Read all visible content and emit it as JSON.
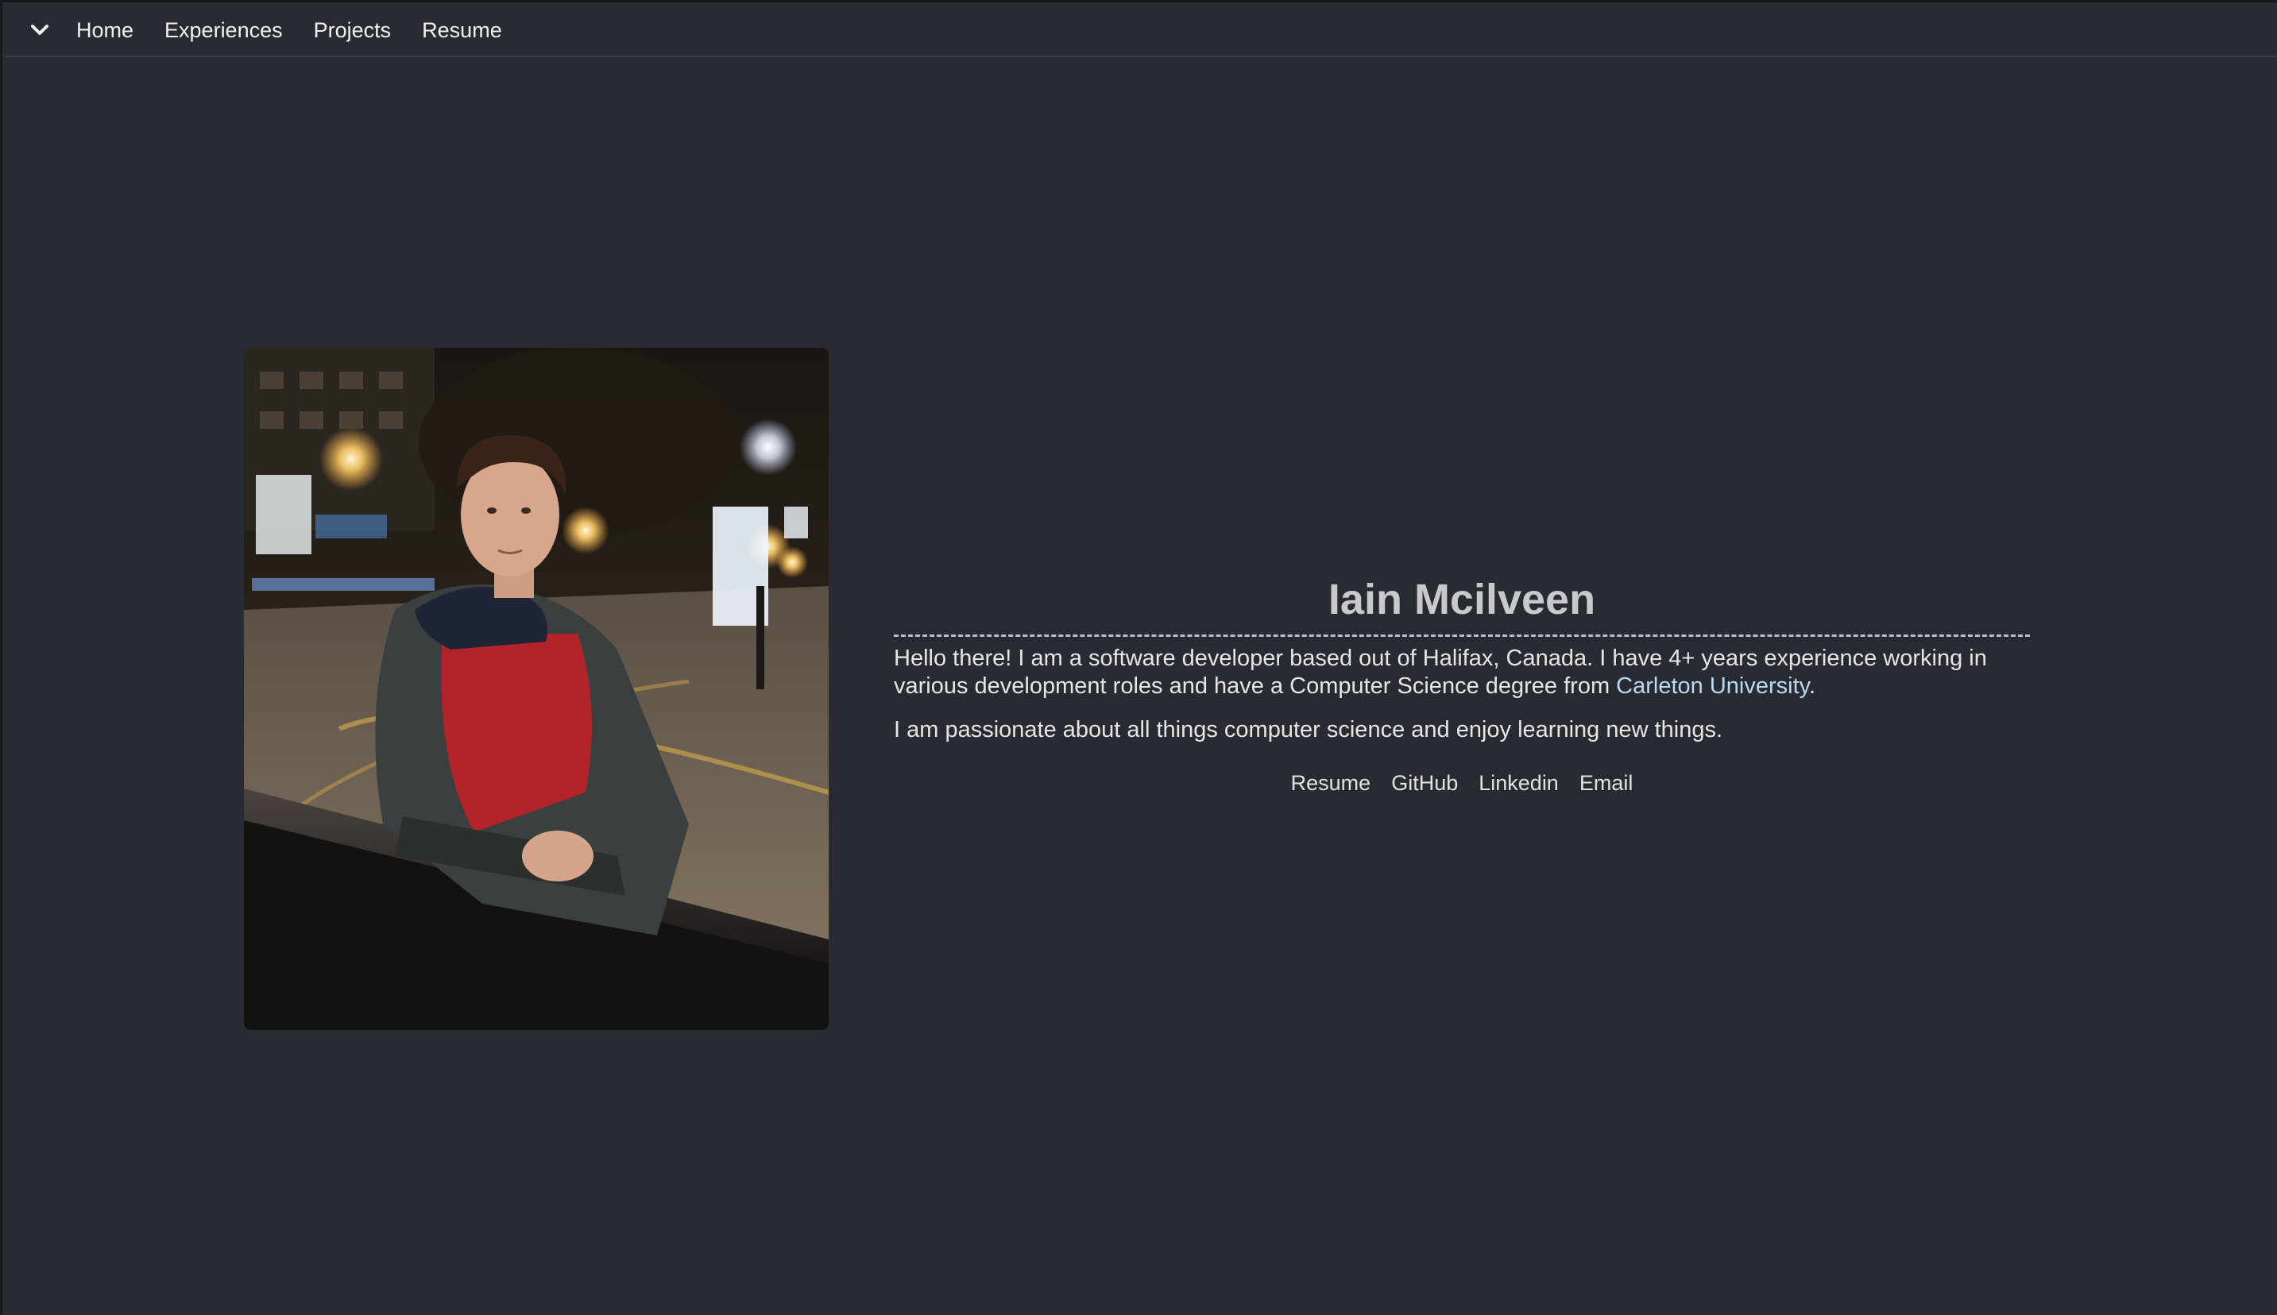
{
  "nav": {
    "toggle_icon": "chevron-down-icon",
    "links": [
      "Home",
      "Experiences",
      "Projects",
      "Resume"
    ]
  },
  "profile": {
    "name": "Iain Mcilveen",
    "bio_lead": "Hello there! I am a software developer based out of Halifax, Canada. I have 4+ years experience working in various development roles and have a Computer Science degree from ",
    "university": "Carleton University",
    "bio_trail": ".",
    "bio_second": "I am passionate about all things computer science and enjoy learning new things.",
    "social_links": [
      "Resume",
      "GitHub",
      "Linkedin",
      "Email"
    ]
  },
  "colors": {
    "background": "#292b32",
    "accent_link": "#b9d9f2",
    "text": "#e6e6e6"
  }
}
